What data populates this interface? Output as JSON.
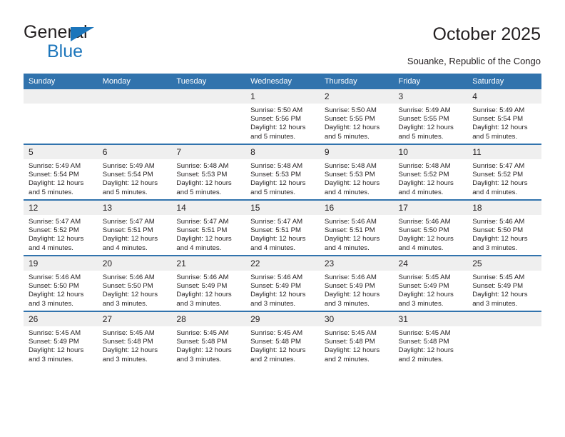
{
  "brand": {
    "name_line1": "General",
    "name_line2": "Blue",
    "primary_color": "#1b75bb",
    "header_color": "#3173ad"
  },
  "header": {
    "title": "October 2025",
    "subtitle": "Souanke, Republic of the Congo"
  },
  "calendar": {
    "weekday_headers": [
      "Sunday",
      "Monday",
      "Tuesday",
      "Wednesday",
      "Thursday",
      "Friday",
      "Saturday"
    ],
    "weeks": [
      [
        {
          "day": "",
          "empty": true,
          "sunrise": "",
          "sunset": "",
          "daylight_line1": "",
          "daylight_line2": ""
        },
        {
          "day": "",
          "empty": true,
          "sunrise": "",
          "sunset": "",
          "daylight_line1": "",
          "daylight_line2": ""
        },
        {
          "day": "",
          "empty": true,
          "sunrise": "",
          "sunset": "",
          "daylight_line1": "",
          "daylight_line2": ""
        },
        {
          "day": "1",
          "empty": false,
          "sunrise": "Sunrise: 5:50 AM",
          "sunset": "Sunset: 5:56 PM",
          "daylight_line1": "Daylight: 12 hours",
          "daylight_line2": "and 5 minutes."
        },
        {
          "day": "2",
          "empty": false,
          "sunrise": "Sunrise: 5:50 AM",
          "sunset": "Sunset: 5:55 PM",
          "daylight_line1": "Daylight: 12 hours",
          "daylight_line2": "and 5 minutes."
        },
        {
          "day": "3",
          "empty": false,
          "sunrise": "Sunrise: 5:49 AM",
          "sunset": "Sunset: 5:55 PM",
          "daylight_line1": "Daylight: 12 hours",
          "daylight_line2": "and 5 minutes."
        },
        {
          "day": "4",
          "empty": false,
          "sunrise": "Sunrise: 5:49 AM",
          "sunset": "Sunset: 5:54 PM",
          "daylight_line1": "Daylight: 12 hours",
          "daylight_line2": "and 5 minutes."
        }
      ],
      [
        {
          "day": "5",
          "empty": false,
          "sunrise": "Sunrise: 5:49 AM",
          "sunset": "Sunset: 5:54 PM",
          "daylight_line1": "Daylight: 12 hours",
          "daylight_line2": "and 5 minutes."
        },
        {
          "day": "6",
          "empty": false,
          "sunrise": "Sunrise: 5:49 AM",
          "sunset": "Sunset: 5:54 PM",
          "daylight_line1": "Daylight: 12 hours",
          "daylight_line2": "and 5 minutes."
        },
        {
          "day": "7",
          "empty": false,
          "sunrise": "Sunrise: 5:48 AM",
          "sunset": "Sunset: 5:53 PM",
          "daylight_line1": "Daylight: 12 hours",
          "daylight_line2": "and 5 minutes."
        },
        {
          "day": "8",
          "empty": false,
          "sunrise": "Sunrise: 5:48 AM",
          "sunset": "Sunset: 5:53 PM",
          "daylight_line1": "Daylight: 12 hours",
          "daylight_line2": "and 5 minutes."
        },
        {
          "day": "9",
          "empty": false,
          "sunrise": "Sunrise: 5:48 AM",
          "sunset": "Sunset: 5:53 PM",
          "daylight_line1": "Daylight: 12 hours",
          "daylight_line2": "and 4 minutes."
        },
        {
          "day": "10",
          "empty": false,
          "sunrise": "Sunrise: 5:48 AM",
          "sunset": "Sunset: 5:52 PM",
          "daylight_line1": "Daylight: 12 hours",
          "daylight_line2": "and 4 minutes."
        },
        {
          "day": "11",
          "empty": false,
          "sunrise": "Sunrise: 5:47 AM",
          "sunset": "Sunset: 5:52 PM",
          "daylight_line1": "Daylight: 12 hours",
          "daylight_line2": "and 4 minutes."
        }
      ],
      [
        {
          "day": "12",
          "empty": false,
          "sunrise": "Sunrise: 5:47 AM",
          "sunset": "Sunset: 5:52 PM",
          "daylight_line1": "Daylight: 12 hours",
          "daylight_line2": "and 4 minutes."
        },
        {
          "day": "13",
          "empty": false,
          "sunrise": "Sunrise: 5:47 AM",
          "sunset": "Sunset: 5:51 PM",
          "daylight_line1": "Daylight: 12 hours",
          "daylight_line2": "and 4 minutes."
        },
        {
          "day": "14",
          "empty": false,
          "sunrise": "Sunrise: 5:47 AM",
          "sunset": "Sunset: 5:51 PM",
          "daylight_line1": "Daylight: 12 hours",
          "daylight_line2": "and 4 minutes."
        },
        {
          "day": "15",
          "empty": false,
          "sunrise": "Sunrise: 5:47 AM",
          "sunset": "Sunset: 5:51 PM",
          "daylight_line1": "Daylight: 12 hours",
          "daylight_line2": "and 4 minutes."
        },
        {
          "day": "16",
          "empty": false,
          "sunrise": "Sunrise: 5:46 AM",
          "sunset": "Sunset: 5:51 PM",
          "daylight_line1": "Daylight: 12 hours",
          "daylight_line2": "and 4 minutes."
        },
        {
          "day": "17",
          "empty": false,
          "sunrise": "Sunrise: 5:46 AM",
          "sunset": "Sunset: 5:50 PM",
          "daylight_line1": "Daylight: 12 hours",
          "daylight_line2": "and 4 minutes."
        },
        {
          "day": "18",
          "empty": false,
          "sunrise": "Sunrise: 5:46 AM",
          "sunset": "Sunset: 5:50 PM",
          "daylight_line1": "Daylight: 12 hours",
          "daylight_line2": "and 3 minutes."
        }
      ],
      [
        {
          "day": "19",
          "empty": false,
          "sunrise": "Sunrise: 5:46 AM",
          "sunset": "Sunset: 5:50 PM",
          "daylight_line1": "Daylight: 12 hours",
          "daylight_line2": "and 3 minutes."
        },
        {
          "day": "20",
          "empty": false,
          "sunrise": "Sunrise: 5:46 AM",
          "sunset": "Sunset: 5:50 PM",
          "daylight_line1": "Daylight: 12 hours",
          "daylight_line2": "and 3 minutes."
        },
        {
          "day": "21",
          "empty": false,
          "sunrise": "Sunrise: 5:46 AM",
          "sunset": "Sunset: 5:49 PM",
          "daylight_line1": "Daylight: 12 hours",
          "daylight_line2": "and 3 minutes."
        },
        {
          "day": "22",
          "empty": false,
          "sunrise": "Sunrise: 5:46 AM",
          "sunset": "Sunset: 5:49 PM",
          "daylight_line1": "Daylight: 12 hours",
          "daylight_line2": "and 3 minutes."
        },
        {
          "day": "23",
          "empty": false,
          "sunrise": "Sunrise: 5:46 AM",
          "sunset": "Sunset: 5:49 PM",
          "daylight_line1": "Daylight: 12 hours",
          "daylight_line2": "and 3 minutes."
        },
        {
          "day": "24",
          "empty": false,
          "sunrise": "Sunrise: 5:45 AM",
          "sunset": "Sunset: 5:49 PM",
          "daylight_line1": "Daylight: 12 hours",
          "daylight_line2": "and 3 minutes."
        },
        {
          "day": "25",
          "empty": false,
          "sunrise": "Sunrise: 5:45 AM",
          "sunset": "Sunset: 5:49 PM",
          "daylight_line1": "Daylight: 12 hours",
          "daylight_line2": "and 3 minutes."
        }
      ],
      [
        {
          "day": "26",
          "empty": false,
          "sunrise": "Sunrise: 5:45 AM",
          "sunset": "Sunset: 5:49 PM",
          "daylight_line1": "Daylight: 12 hours",
          "daylight_line2": "and 3 minutes."
        },
        {
          "day": "27",
          "empty": false,
          "sunrise": "Sunrise: 5:45 AM",
          "sunset": "Sunset: 5:48 PM",
          "daylight_line1": "Daylight: 12 hours",
          "daylight_line2": "and 3 minutes."
        },
        {
          "day": "28",
          "empty": false,
          "sunrise": "Sunrise: 5:45 AM",
          "sunset": "Sunset: 5:48 PM",
          "daylight_line1": "Daylight: 12 hours",
          "daylight_line2": "and 3 minutes."
        },
        {
          "day": "29",
          "empty": false,
          "sunrise": "Sunrise: 5:45 AM",
          "sunset": "Sunset: 5:48 PM",
          "daylight_line1": "Daylight: 12 hours",
          "daylight_line2": "and 2 minutes."
        },
        {
          "day": "30",
          "empty": false,
          "sunrise": "Sunrise: 5:45 AM",
          "sunset": "Sunset: 5:48 PM",
          "daylight_line1": "Daylight: 12 hours",
          "daylight_line2": "and 2 minutes."
        },
        {
          "day": "31",
          "empty": false,
          "sunrise": "Sunrise: 5:45 AM",
          "sunset": "Sunset: 5:48 PM",
          "daylight_line1": "Daylight: 12 hours",
          "daylight_line2": "and 2 minutes."
        },
        {
          "day": "",
          "empty": true,
          "sunrise": "",
          "sunset": "",
          "daylight_line1": "",
          "daylight_line2": ""
        }
      ]
    ]
  }
}
